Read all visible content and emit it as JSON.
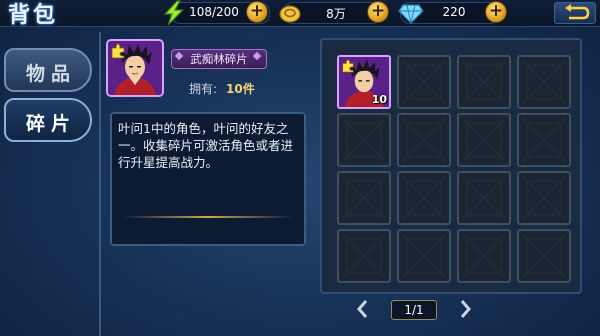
{
  "header": {
    "title": "背包",
    "energy": "108/200",
    "gold": "8万",
    "diamonds": "220"
  },
  "tabs": [
    {
      "label": "物品",
      "active": false
    },
    {
      "label": "碎片",
      "active": true
    }
  ],
  "selected_item": {
    "name": "武痴林碎片",
    "owned_label": "拥有:",
    "owned_value": "10件",
    "description": "叶问1中的角色，叶问的好友之一。收集碎片可激活角色或者进行升星提高战力。",
    "icon": "fighter-portrait-icon"
  },
  "grid": {
    "slots": [
      {
        "filled": true,
        "count": "10"
      },
      {
        "filled": false
      },
      {
        "filled": false
      },
      {
        "filled": false
      },
      {
        "filled": false
      },
      {
        "filled": false
      },
      {
        "filled": false
      },
      {
        "filled": false
      },
      {
        "filled": false
      },
      {
        "filled": false
      },
      {
        "filled": false
      },
      {
        "filled": false
      },
      {
        "filled": false
      },
      {
        "filled": false
      },
      {
        "filled": false
      },
      {
        "filled": false
      }
    ]
  },
  "pagination": {
    "page": "1/1"
  },
  "colors": {
    "accent_gold": "#e6c36a",
    "owned_text": "#f3d37a",
    "fragment_purple": "#6b2a9e"
  }
}
